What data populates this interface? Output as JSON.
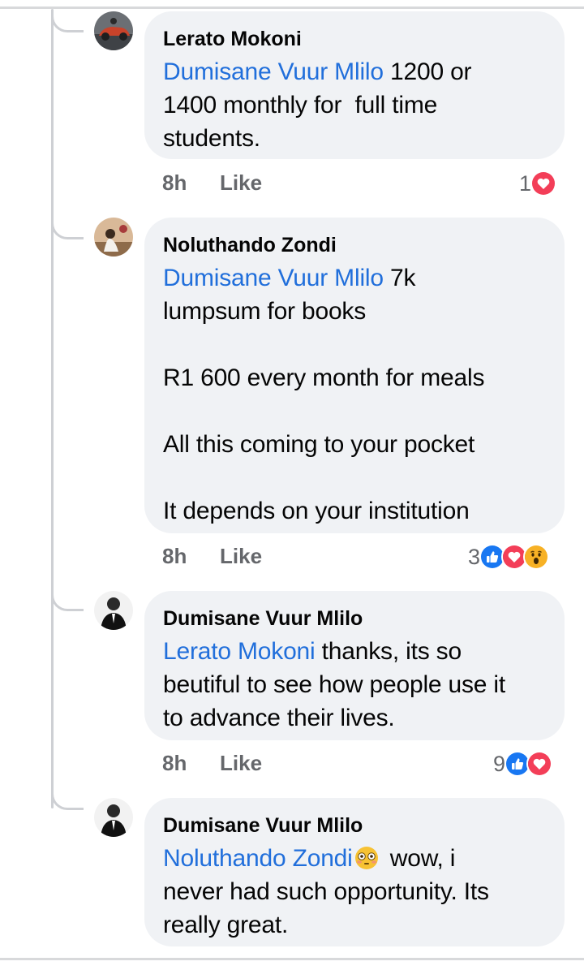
{
  "comments": [
    {
      "author": "Lerato Mokoni",
      "mention": "Dumisane Vuur Mlilo",
      "text": " 1200 or\n1400 monthly for  full time\nstudents.",
      "time": "8h",
      "like_label": "Like",
      "reaction_count": "1",
      "reactions": [
        "love-icon"
      ]
    },
    {
      "author": "Noluthando Zondi",
      "mention": "Dumisane Vuur Mlilo",
      "text": " 7k\nlumpsum for books\n\nR1 600 every month for meals\n\nAll this coming to your pocket\n\nIt depends on your institution",
      "time": "8h",
      "like_label": "Like",
      "reaction_count": "3",
      "reactions": [
        "like-icon",
        "love-icon",
        "wow-icon"
      ]
    },
    {
      "author": "Dumisane Vuur Mlilo",
      "mention": "Lerato Mokoni",
      "text": " thanks, its so\nbeutiful to see how people use it\nto advance their lives.",
      "time": "8h",
      "like_label": "Like",
      "reaction_count": "9",
      "reactions": [
        "like-icon",
        "love-icon"
      ]
    },
    {
      "author": "Dumisane Vuur Mlilo",
      "mention": "Noluthando Zondi",
      "emoji": "flushed-face-emoji",
      "text": " wow, i\nnever had such opportunity. Its\nreally great."
    }
  ],
  "colors": {
    "mention": "#216fdb",
    "bubble": "#f0f2f5",
    "meta": "#65676b",
    "like_reaction": "#1877f2",
    "love_reaction": "#f33e58",
    "wow_reaction": "#f7b125"
  }
}
